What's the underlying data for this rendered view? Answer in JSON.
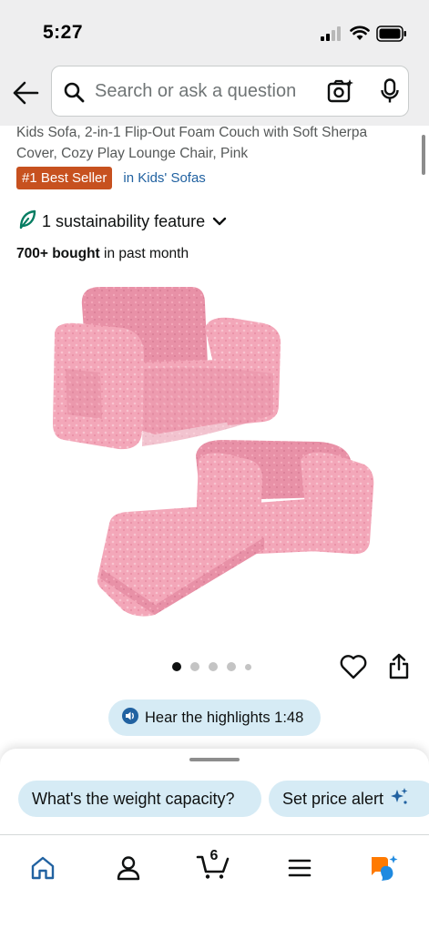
{
  "status_bar": {
    "time": "5:27"
  },
  "search": {
    "placeholder": "Search or ask a question"
  },
  "product": {
    "title": "Kids Sofa, 2-in-1 Flip-Out Foam Couch with Soft Sherpa Cover, Cozy Play Lounge Chair, Pink",
    "best_seller_badge": "#1 Best Seller",
    "category_link": "in Kids' Sofas",
    "sustainability": "1 sustainability feature",
    "bought_bold": "700+ bought",
    "bought_rest": " in past month",
    "image_count": 5,
    "active_image_index": 0
  },
  "hear_highlights": {
    "label": "Hear the highlights 1:48"
  },
  "suggestions": [
    {
      "label": "What's the weight capacity?"
    },
    {
      "label": "Set price alert"
    }
  ],
  "bottom_nav": {
    "cart_count": "6",
    "items": [
      "home-icon",
      "account-icon",
      "cart-icon",
      "menu-icon",
      "rufus-icon"
    ]
  },
  "colors": {
    "accent_blue": "#2162a1",
    "badge_orange": "#c7511f",
    "pill_blue": "#d6ebf5",
    "sofa_pink": "#f3a7b9",
    "rufus_orange": "#ff7a00",
    "rufus_blue": "#1f8ae0"
  }
}
